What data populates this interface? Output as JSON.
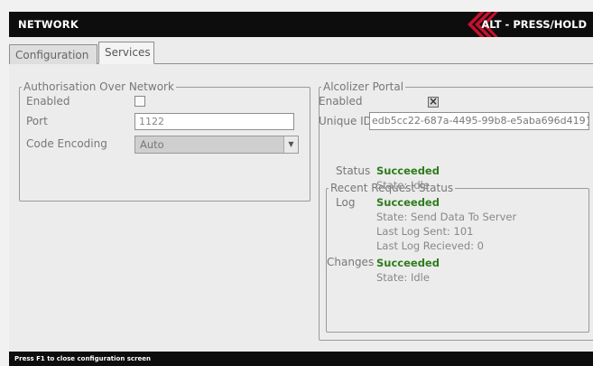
{
  "header": {
    "title": "NETWORK",
    "action_label": "ALT - PRESS/HOLD",
    "accent_color": "#c8102e"
  },
  "tabs": [
    {
      "label": "Configuration",
      "active": false
    },
    {
      "label": "Services",
      "active": true
    }
  ],
  "auth_group": {
    "legend": "Authorisation Over Network",
    "enabled_label": "Enabled",
    "enabled_checked": false,
    "port_label": "Port",
    "port_value": "1122",
    "encoding_label": "Code Encoding",
    "encoding_value": "Auto"
  },
  "alcolizer_group": {
    "legend": "Alcolizer Portal",
    "enabled_label": "Enabled",
    "enabled_checked": true,
    "unique_id_label": "Unique ID",
    "unique_id_value": "edb5cc22-687a-4495-99b8-e5aba696d419}"
  },
  "recent_status": {
    "legend": "Recent Request Status",
    "status_label": "Status",
    "status_result": "Succeeded",
    "status_state": "State: Idle",
    "log_label": "Log",
    "log_result": "Succeeded",
    "log_state": "State: Send Data To Server",
    "log_last_sent": "Last Log Sent: 101",
    "log_last_received": "Last Log Recieved: 0",
    "changes_label": "Changes",
    "changes_result": "Succeeded",
    "changes_state": "State: Idle"
  },
  "footer": {
    "hint": "Press F1 to close configuration screen"
  }
}
